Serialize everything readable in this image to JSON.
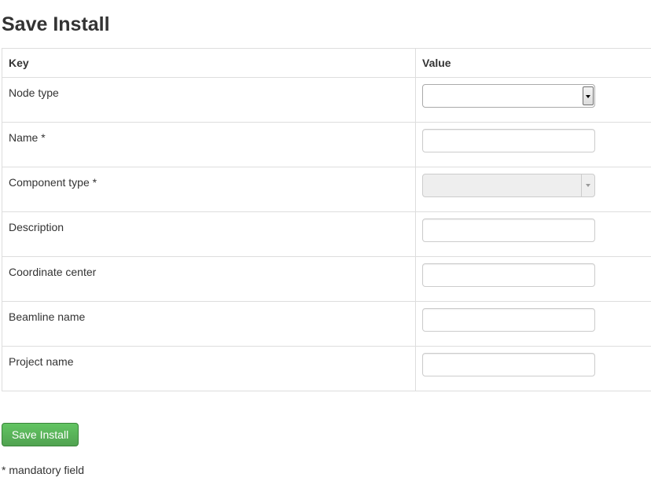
{
  "title": "Save Install",
  "table": {
    "headers": {
      "key": "Key",
      "value": "Value"
    },
    "rows": [
      {
        "label": "Node type",
        "control": "select",
        "value": ""
      },
      {
        "label": "Name *",
        "control": "text",
        "value": ""
      },
      {
        "label": "Component type *",
        "control": "select-disabled",
        "value": ""
      },
      {
        "label": "Description",
        "control": "text",
        "value": ""
      },
      {
        "label": "Coordinate center",
        "control": "text",
        "value": ""
      },
      {
        "label": "Beamline name",
        "control": "text",
        "value": ""
      },
      {
        "label": "Project name",
        "control": "text",
        "value": ""
      }
    ]
  },
  "save_button": {
    "label": "Save Install",
    "color": "#5cb85c"
  },
  "footnote": "* mandatory field",
  "icons": {
    "dropdown": "chevron-down-icon"
  }
}
